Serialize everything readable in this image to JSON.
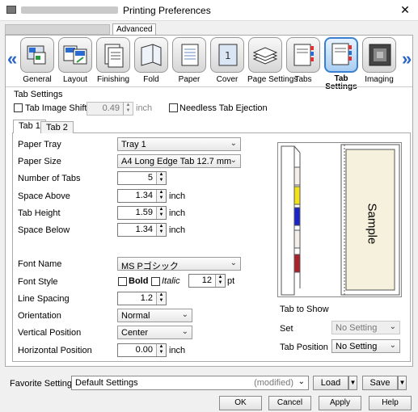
{
  "window": {
    "title": "Printing Preferences",
    "close_glyph": "✕"
  },
  "top_tabs": {
    "advanced": "Advanced"
  },
  "toolbar": {
    "items": [
      "General",
      "Layout",
      "Finishing",
      "Fold",
      "Paper",
      "Cover",
      "Page Settings",
      "Tabs",
      "Tab Settings",
      "Imaging"
    ],
    "selected": "Tab Settings",
    "left_arrow": "«",
    "right_arrow": "»"
  },
  "tab_settings": {
    "group_label": "Tab Settings",
    "tab_image_shift_label": "Tab Image Shift",
    "tab_image_shift_value": "0.49",
    "tab_image_shift_unit": "inch",
    "needless_tab_ejection_label": "Needless Tab Ejection"
  },
  "inner_tabs": [
    "Tab 1",
    "Tab 2"
  ],
  "form": {
    "paper_tray": {
      "label": "Paper Tray",
      "value": "Tray 1"
    },
    "paper_size": {
      "label": "Paper Size",
      "value": "A4 Long Edge Tab 12.7 mm"
    },
    "number_of_tabs": {
      "label": "Number of Tabs",
      "value": "5"
    },
    "space_above": {
      "label": "Space Above",
      "value": "1.34",
      "unit": "inch"
    },
    "tab_height": {
      "label": "Tab Height",
      "value": "1.59",
      "unit": "inch"
    },
    "space_below": {
      "label": "Space Below",
      "value": "1.34",
      "unit": "inch"
    },
    "font_name": {
      "label": "Font Name",
      "value": "MS Pゴシック"
    },
    "font_style": {
      "label": "Font Style",
      "bold": "Bold",
      "italic": "Italic",
      "size": "12",
      "unit": "pt"
    },
    "line_spacing": {
      "label": "Line Spacing",
      "value": "1.2"
    },
    "orientation": {
      "label": "Orientation",
      "value": "Normal"
    },
    "vertical_position": {
      "label": "Vertical Position",
      "value": "Center"
    },
    "horizontal_position": {
      "label": "Horizontal Position",
      "value": "0.00",
      "unit": "inch"
    }
  },
  "preview": {
    "sample_text": "Sample",
    "tab_colors": [
      "#f4efe8",
      "#f2e21a",
      "#1a24c8",
      "#f4efe8",
      "#a8242a"
    ]
  },
  "tab_to_show": {
    "heading": "Tab to Show",
    "set_label": "Set",
    "set_value": "No Setting",
    "tab_position_label": "Tab Position",
    "tab_position_value": "No Setting"
  },
  "favorite": {
    "label": "Favorite Setting",
    "value": "Default Settings",
    "modified": "(modified)",
    "load": "Load",
    "save": "Save"
  },
  "buttons": {
    "ok": "OK",
    "cancel": "Cancel",
    "apply": "Apply",
    "help": "Help"
  }
}
